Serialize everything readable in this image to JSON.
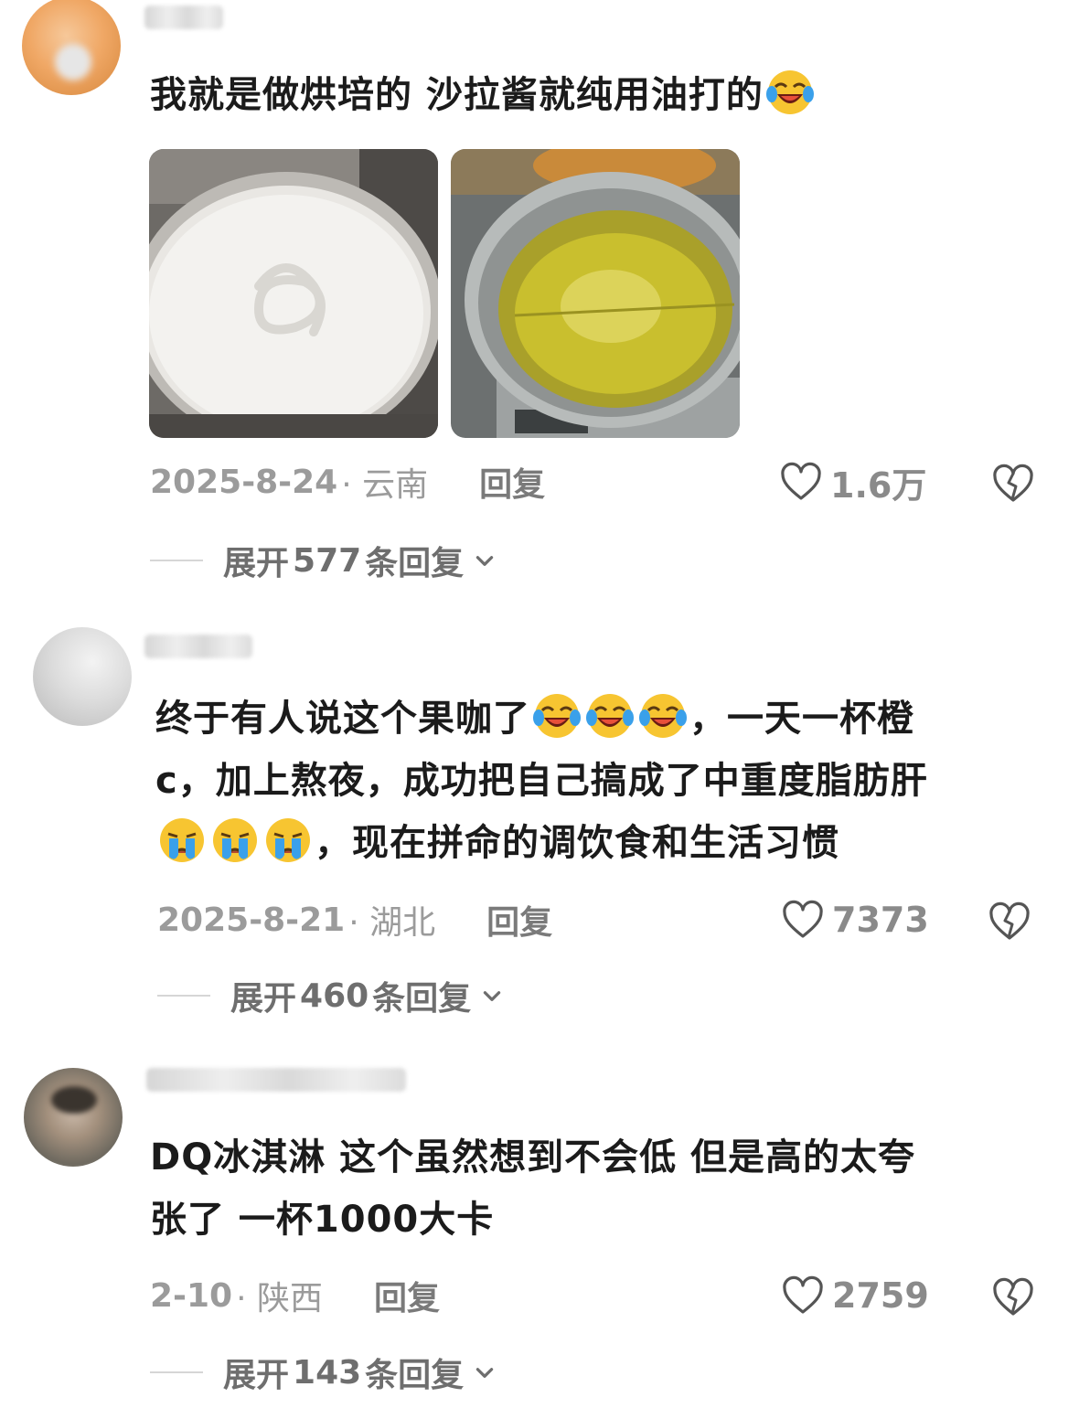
{
  "comments": [
    {
      "text": "我就是做烘培的 沙拉酱就纯用油打的",
      "date": "2025-8-24",
      "location": "· 云南",
      "reply_label": "回复",
      "likes": "1.6万",
      "expand_label_prefix": "展开",
      "expand_count": "577",
      "expand_label_suffix": "条回复"
    },
    {
      "text_line1": "终于有人说这个果咖了",
      "text_line1_tail": "，一天一杯橙",
      "text_line2": "c，加上熬夜，成功把自己搞成了中重度脂肪肝",
      "text_line3_tail": "，现在拼命的调饮食和生活习惯",
      "date": "2025-8-21",
      "location": "· 湖北",
      "reply_label": "回复",
      "likes": "7373",
      "expand_label_prefix": "展开",
      "expand_count": "460",
      "expand_label_suffix": "条回复"
    },
    {
      "text_line1": "DQ冰淇淋 这个虽然想到不会低 但是高的太夸",
      "text_line2": "张了 一杯1000大卡",
      "date": "2-10",
      "location": "· 陕西",
      "reply_label": "回复",
      "likes": "2759",
      "expand_label_prefix": "展开",
      "expand_count": "143",
      "expand_label_suffix": "条回复"
    }
  ],
  "icons": {
    "laugh_cry": "laughing-crying-emoji-icon",
    "crying": "crying-emoji-icon",
    "like": "heart-icon",
    "dislike": "broken-heart-icon",
    "expand": "chevron-down-icon"
  },
  "colors": {
    "text": "#1b1b1b",
    "meta": "#9b9b9b",
    "emoji_yellow": "#f7c531",
    "emoji_tear": "#3aa0ea"
  }
}
